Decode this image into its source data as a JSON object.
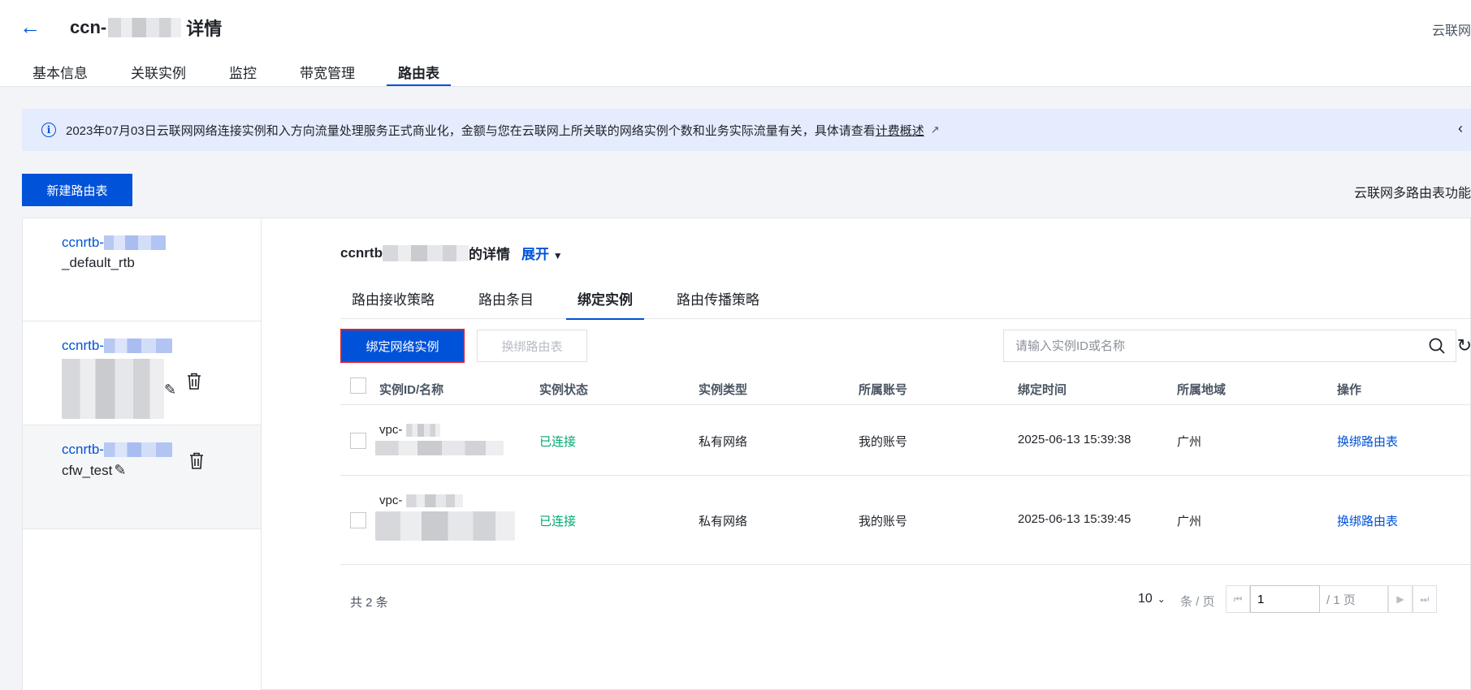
{
  "header": {
    "back_icon": "arrow-left-icon",
    "title_prefix": "ccn-",
    "title_suffix": "详情",
    "top_right": "云联网",
    "tabs": [
      "基本信息",
      "关联实例",
      "监控",
      "带宽管理",
      "路由表"
    ],
    "active_tab": "路由表"
  },
  "notice": {
    "icon": "info-icon",
    "text": "2023年07月03日云联网网络连接实例和入方向流量处理服务正式商业化，金额与您在云联网上所关联的网络实例个数和业务实际流量有关，具体请查看",
    "link": "计费概述"
  },
  "toolbar": {
    "new_button": "新建路由表",
    "right_text": "云联网多路由表功能"
  },
  "sidebar": {
    "items": [
      {
        "id_prefix": "ccnrtb-",
        "name": "_default_rtb"
      },
      {
        "id_prefix": "ccnrtb-",
        "name": ""
      },
      {
        "id_prefix": "ccnrtb-",
        "name": "cfw_test"
      }
    ]
  },
  "detail": {
    "title_prefix": "ccnrtb",
    "title_suffix": "的详情",
    "expand": "展开",
    "tabs": [
      "路由接收策略",
      "路由条目",
      "绑定实例",
      "路由传播策略"
    ],
    "active_tab": "绑定实例",
    "bind_button": "绑定网络实例",
    "rebind_button": "换绑路由表",
    "search_placeholder": "请输入实例ID或名称"
  },
  "table": {
    "columns": [
      "实例ID/名称",
      "实例状态",
      "实例类型",
      "所属账号",
      "绑定时间",
      "所属地域",
      "操作"
    ],
    "rows": [
      {
        "id_prefix": "vpc-",
        "status": "已连接",
        "type": "私有网络",
        "account": "我的账号",
        "time": "2025-06-13 15:39:38",
        "region": "广州",
        "action": "换绑路由表"
      },
      {
        "id_prefix": "vpc-",
        "status": "已连接",
        "type": "私有网络",
        "account": "我的账号",
        "time": "2025-06-13 15:39:45",
        "region": "广州",
        "action": "换绑路由表"
      }
    ]
  },
  "pagination": {
    "total": "共 2 条",
    "page_size": "10",
    "page_size_unit": "条 / 页",
    "current_page": "1",
    "total_pages": "/ 1 页"
  },
  "colors": {
    "primary": "#0052d9",
    "success": "#00a870",
    "highlight_border": "#e21c2a"
  }
}
